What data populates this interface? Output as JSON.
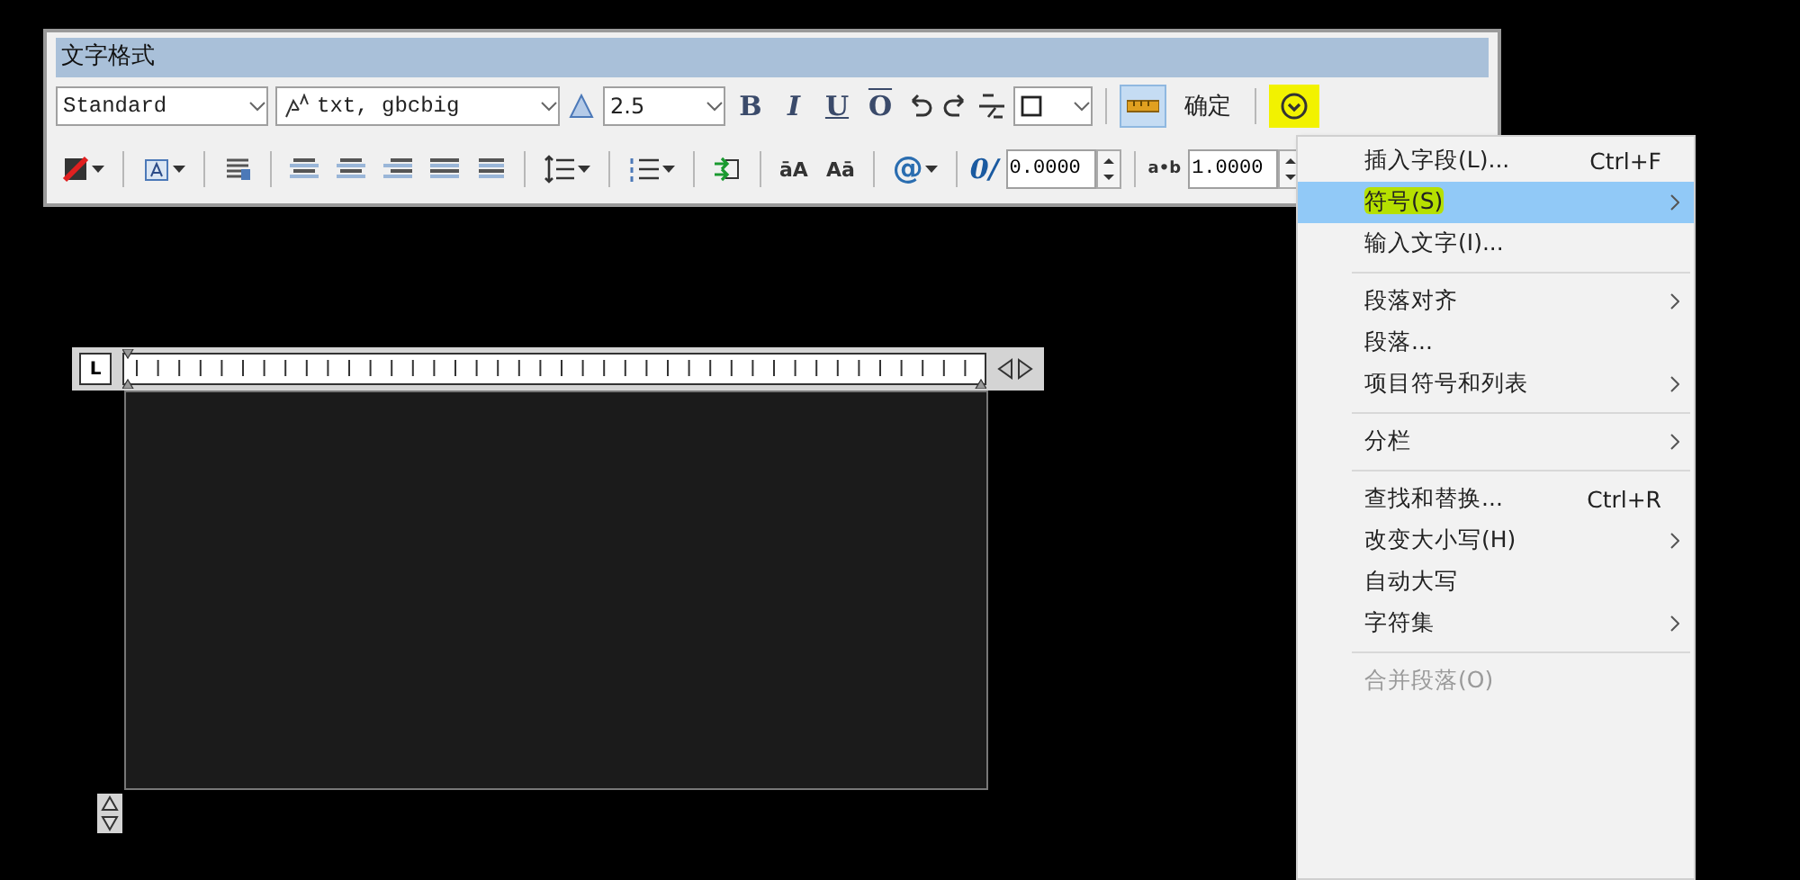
{
  "panel": {
    "title": "文字格式"
  },
  "toolbar_row_1": {
    "style": {
      "value": "Standard"
    },
    "font": {
      "value": "txt, gbcbig"
    },
    "text_height": {
      "value": "2.5"
    },
    "format_buttons": [
      {
        "label": "B",
        "kind": "bold"
      },
      {
        "label": "I",
        "kind": "italic"
      },
      {
        "label": "U",
        "kind": "underline"
      },
      {
        "label": "O",
        "kind": "overline"
      }
    ],
    "ruler_toggle": {
      "selected": true
    },
    "ok_button": "确定",
    "options_button": {
      "highlighted": true
    }
  },
  "toolbar_row_2": {
    "case_buttons": [
      "āA",
      "Aā"
    ],
    "symbol_button": "@",
    "oblique": {
      "icon": "0/",
      "value": "0.0000"
    },
    "tracking": {
      "icon": "a•b",
      "value": "1.0000"
    }
  },
  "context_menu": {
    "groups": [
      [
        {
          "label": "插入字段(L)...",
          "shortcut": "Ctrl+F",
          "submenu": false,
          "selected": false,
          "highlighted": false,
          "disabled": false
        },
        {
          "label": "符号(S)",
          "submenu": true,
          "selected": true,
          "highlighted": true,
          "disabled": false
        },
        {
          "label": "输入文字(I)...",
          "submenu": false,
          "selected": false,
          "highlighted": false,
          "disabled": false
        }
      ],
      [
        {
          "label": "段落对齐",
          "submenu": true,
          "selected": false,
          "highlighted": false,
          "disabled": false
        },
        {
          "label": "段落...",
          "submenu": false,
          "selected": false,
          "highlighted": false,
          "disabled": false
        },
        {
          "label": "项目符号和列表",
          "submenu": true,
          "selected": false,
          "highlighted": false,
          "disabled": false
        }
      ],
      [
        {
          "label": "分栏",
          "submenu": true,
          "selected": false,
          "highlighted": false,
          "disabled": false
        }
      ],
      [
        {
          "label": "查找和替换...",
          "shortcut": "Ctrl+R",
          "submenu": false,
          "selected": false,
          "highlighted": false,
          "disabled": false
        },
        {
          "label": "改变大小写(H)",
          "submenu": true,
          "selected": false,
          "highlighted": false,
          "disabled": false
        },
        {
          "label": "自动大写",
          "submenu": false,
          "selected": false,
          "highlighted": false,
          "disabled": false
        },
        {
          "label": "字符集",
          "submenu": true,
          "selected": false,
          "highlighted": false,
          "disabled": false
        }
      ],
      [
        {
          "label": "合并段落(O)",
          "submenu": false,
          "selected": false,
          "highlighted": false,
          "disabled": true
        }
      ]
    ]
  },
  "ruler": {
    "tab_button": "L"
  }
}
